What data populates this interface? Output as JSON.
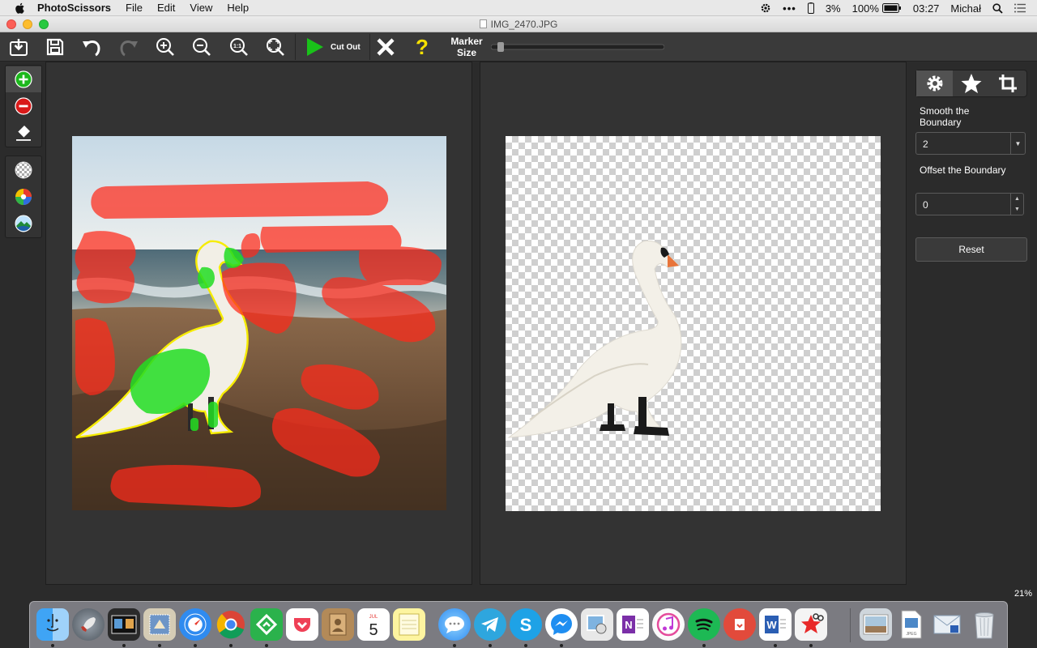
{
  "menubar": {
    "app_name": "PhotoScissors",
    "menus": [
      "File",
      "Edit",
      "View",
      "Help"
    ],
    "battery_percent_small": "3%",
    "battery_percent": "100%",
    "clock": "03:27",
    "user": "Michał"
  },
  "window": {
    "title": "IMG_2470.JPG"
  },
  "toolbar": {
    "cutout_label": "Cut Out",
    "marker_label": "Marker Size",
    "marker_value": "14",
    "marker_fraction": 0.04
  },
  "settings": {
    "smooth_label": "Smooth the Boundary",
    "smooth_value": "2",
    "offset_label": "Offset the Boundary",
    "offset_value": "0",
    "reset_label": "Reset"
  },
  "status": {
    "zoom": "21%"
  },
  "colors": {
    "background_marker": "#ff2a1a",
    "foreground_marker": "#22dd22",
    "outline": "#ffee00",
    "accent_green": "#19c219"
  },
  "dock": {
    "calendar_month": "JUL",
    "calendar_day": "5",
    "apps": [
      "finder-icon",
      "launchpad-icon",
      "photos-viewer-icon",
      "mail-icon",
      "safari-icon",
      "chrome-icon",
      "feedly-icon",
      "pocket-icon",
      "contacts-icon",
      "calendar-icon",
      "notes-icon",
      "messages-icon",
      "telegram-icon",
      "skype-icon",
      "messenger-icon",
      "preview-icon",
      "onenote-icon",
      "itunes-icon",
      "spotify-icon",
      "pdf-expert-icon",
      "word-icon",
      "photoscissors-icon",
      "photo-folder-icon",
      "jpeg-file-icon",
      "mail-doc-icon",
      "trash-icon"
    ]
  }
}
